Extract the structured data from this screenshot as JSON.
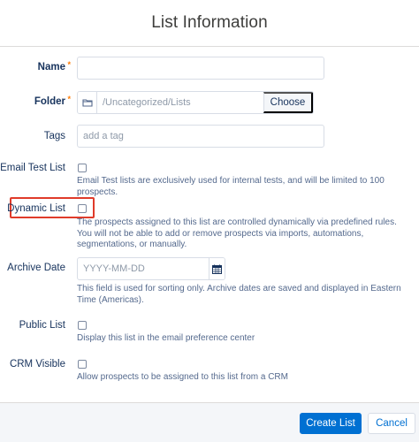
{
  "modal": {
    "title": "List Information"
  },
  "fields": {
    "name": {
      "label": "Name",
      "required_mark": "*",
      "value": ""
    },
    "folder": {
      "label": "Folder",
      "required_mark": "*",
      "path": "/Uncategorized/Lists",
      "choose_label": "Choose"
    },
    "tags": {
      "label": "Tags",
      "placeholder": "add a tag"
    },
    "email_test_list": {
      "label": "Email Test List",
      "checked": false,
      "help": "Email Test lists are exclusively used for internal tests, and will be limited to 100 prospects."
    },
    "dynamic_list": {
      "label": "Dynamic List",
      "checked": false,
      "help_line1": "The prospects assigned to this list are controlled dynamically via predefined rules.",
      "help_line2": "You will not be able to add or remove prospects via imports, automations, segmentations, or manually."
    },
    "archive_date": {
      "label": "Archive Date",
      "placeholder": "YYYY-MM-DD",
      "help": "This field is used for sorting only. Archive dates are saved and displayed in Eastern Time (Americas)."
    },
    "public_list": {
      "label": "Public List",
      "checked": false,
      "help": "Display this list in the email preference center"
    },
    "crm_visible": {
      "label": "CRM Visible",
      "checked": false,
      "help": "Allow prospects to be assigned to this list from a CRM"
    }
  },
  "footer": {
    "primary_label": "Create List",
    "cancel_label": "Cancel"
  },
  "colors": {
    "primary": "#0070d2",
    "highlight": "#e03b2a",
    "required": "#ff7a00"
  },
  "icons": {
    "folder": "folder-icon",
    "calendar": "calendar-icon"
  }
}
